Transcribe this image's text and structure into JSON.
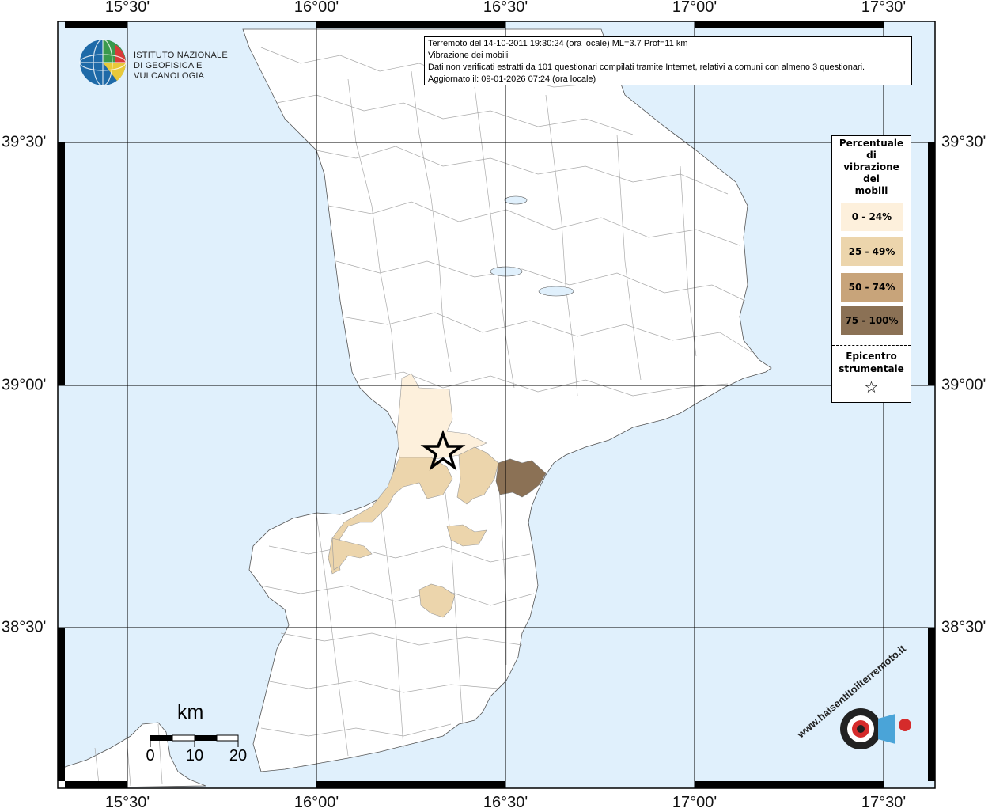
{
  "header": {
    "line1": "Terremoto del 14-10-2011 19:30:24 (ora locale) ML=3.7 Prof=11 km",
    "line2": "Vibrazione dei mobili",
    "line3": "Dati non verificati estratti da 101 questionari compilati tramite Internet, relativi a comuni con almeno 3 questionari.",
    "line4": "Aggiornato il: 09-01-2026 07:24 (ora locale)"
  },
  "logo": {
    "line1": "ISTITUTO NAZIONALE",
    "line2": "DI GEOFISICA E VULCANOLOGIA"
  },
  "axes": {
    "lon_labels": [
      "15°30'",
      "16°00'",
      "16°30'",
      "17°00'",
      "17°30'"
    ],
    "lat_labels": [
      "39°30'",
      "39°00'",
      "38°30'"
    ]
  },
  "legend": {
    "title": [
      "Percentuale",
      "di",
      "vibrazione",
      "del",
      "mobili"
    ],
    "classes": [
      {
        "label": "0 - 24%",
        "color": "#fdf0dc"
      },
      {
        "label": "25 - 49%",
        "color": "#ecd5ac"
      },
      {
        "label": "50 - 74%",
        "color": "#c8a47a"
      },
      {
        "label": "75 - 100%",
        "color": "#8b7155"
      }
    ],
    "epicenter_line1": "Epicentro",
    "epicenter_line2": "strumentale",
    "epicenter_symbol": "☆"
  },
  "scale": {
    "unit": "km",
    "ticks": [
      "0",
      "10",
      "20"
    ]
  },
  "watermark": {
    "site": "www.haisentitoilterremoto.it"
  },
  "colors": {
    "sea": "#e0f0fc",
    "land": "#ffffff",
    "grid": "#000000",
    "border": "#999999"
  }
}
